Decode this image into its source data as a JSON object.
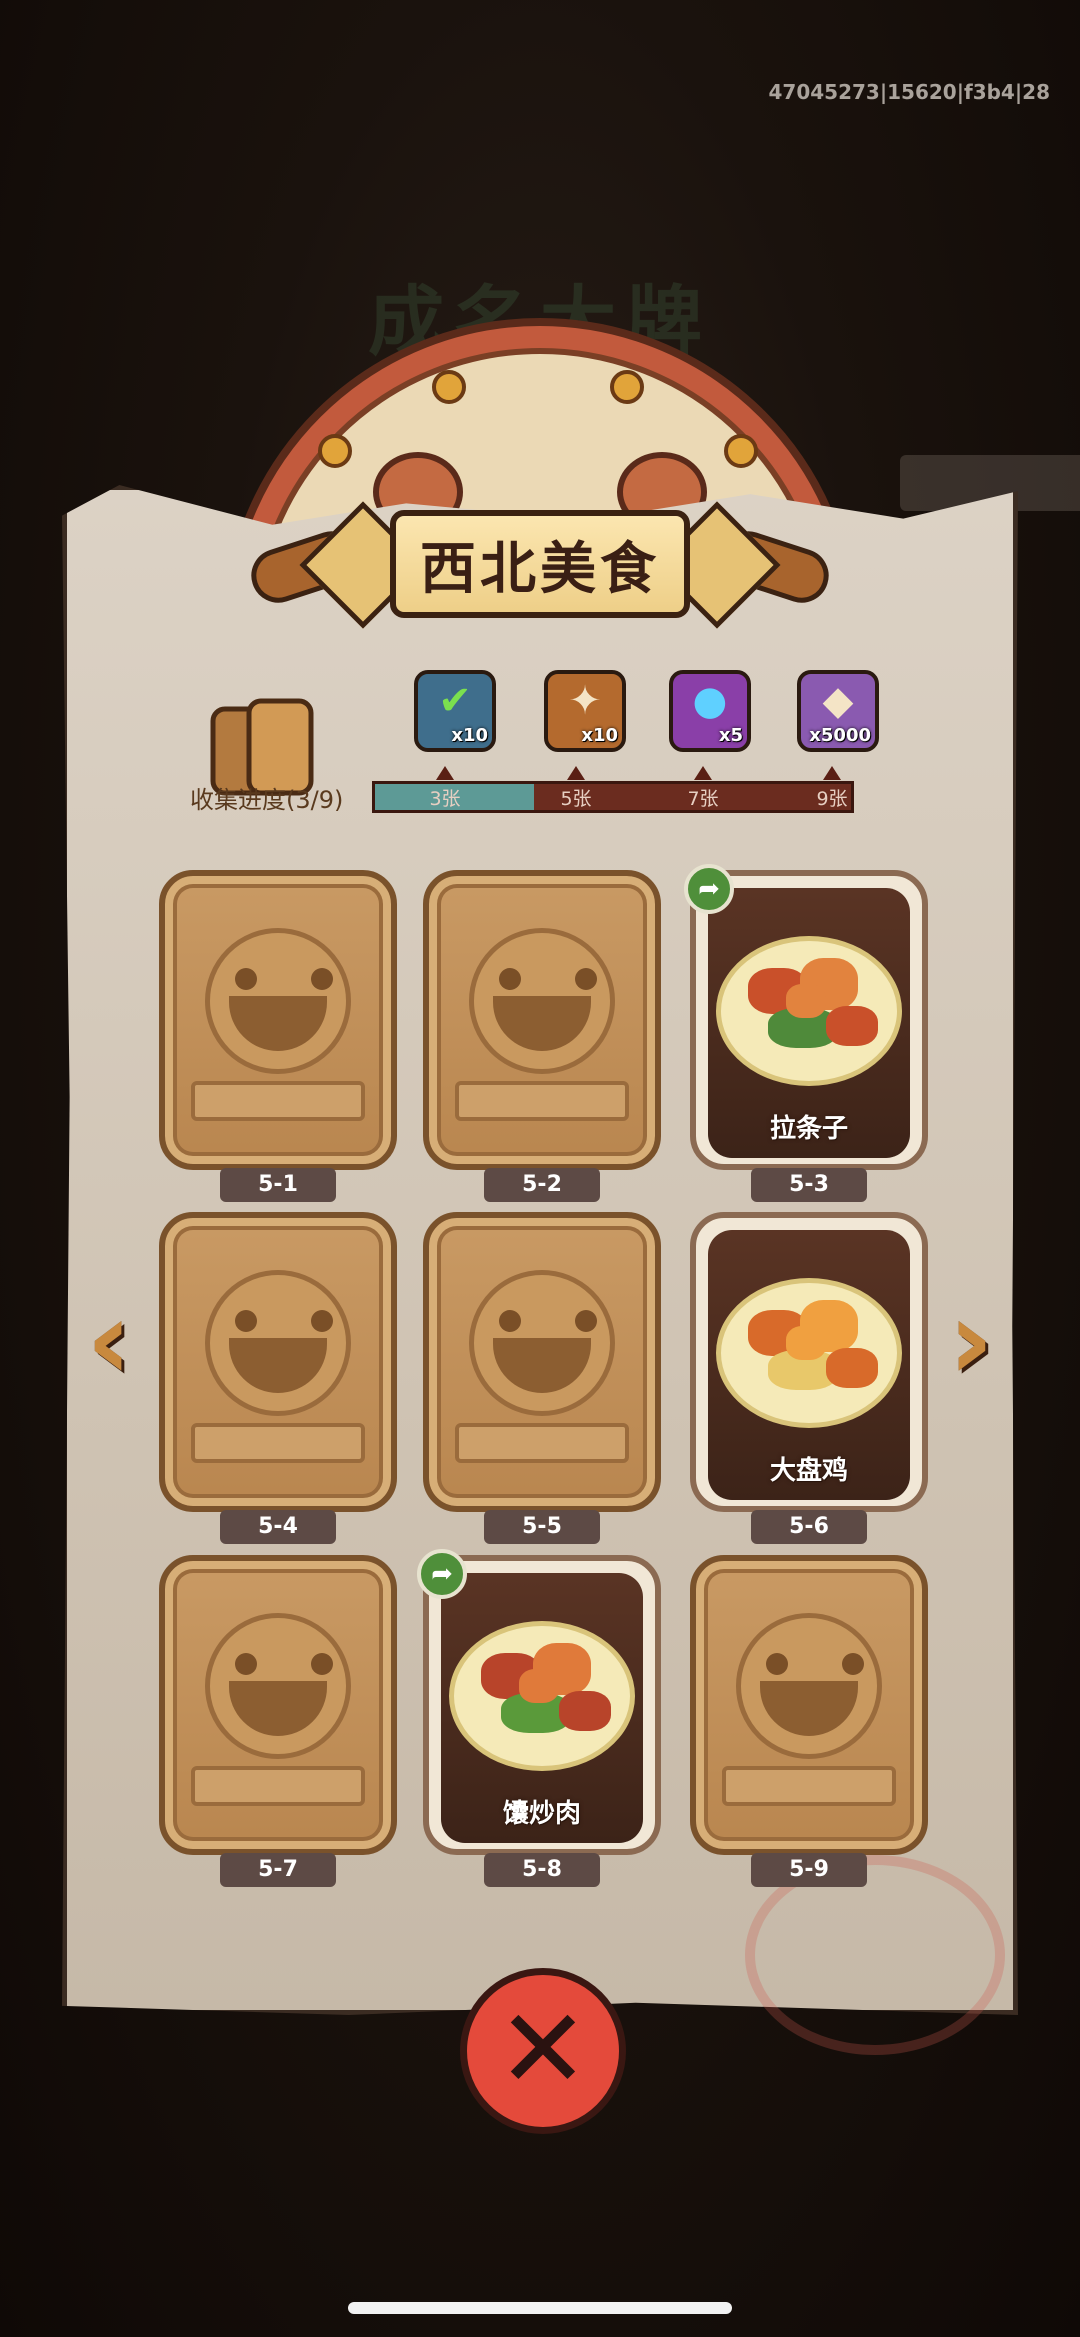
{
  "build_id": "47045273|15620|f3b4|28",
  "background_title": "成名大牌",
  "panel": {
    "title": "西北美食"
  },
  "collection": {
    "label": "收集进度(3/9)",
    "collected": 3,
    "total": 9,
    "progress_fraction": 0.333
  },
  "rewards": [
    {
      "icon": "treasure-chest-check-icon",
      "qty": "x10",
      "color": "#3f6e8c"
    },
    {
      "icon": "key-scroll-icon",
      "qty": "x10",
      "color": "#b46a2e"
    },
    {
      "icon": "magic-orb-icon",
      "qty": "x5",
      "color": "#8a3fa8"
    },
    {
      "icon": "crystal-shard-icon",
      "qty": "x5000",
      "color": "#8a5ab0"
    }
  ],
  "milestones": [
    "3张",
    "5张",
    "7张",
    "9张"
  ],
  "cards": [
    {
      "slot": "5-1",
      "unlocked": false
    },
    {
      "slot": "5-2",
      "unlocked": false
    },
    {
      "slot": "5-3",
      "unlocked": true,
      "name": "拉条子",
      "share": true
    },
    {
      "slot": "5-4",
      "unlocked": false
    },
    {
      "slot": "5-5",
      "unlocked": false
    },
    {
      "slot": "5-6",
      "unlocked": true,
      "name": "大盘鸡",
      "share": false
    },
    {
      "slot": "5-7",
      "unlocked": false
    },
    {
      "slot": "5-8",
      "unlocked": true,
      "name": "馕炒肉",
      "share": true
    },
    {
      "slot": "5-9",
      "unlocked": false
    }
  ],
  "navigation": {
    "prev_icon": "left-arrow-icon",
    "next_icon": "right-arrow-icon"
  },
  "close_icon": "close-x-icon",
  "colors": {
    "progress_fill": "#5d9a96",
    "progress_track": "#6b2c1f",
    "close_button": "#e44a3b",
    "share_button": "#4f8f3a"
  }
}
